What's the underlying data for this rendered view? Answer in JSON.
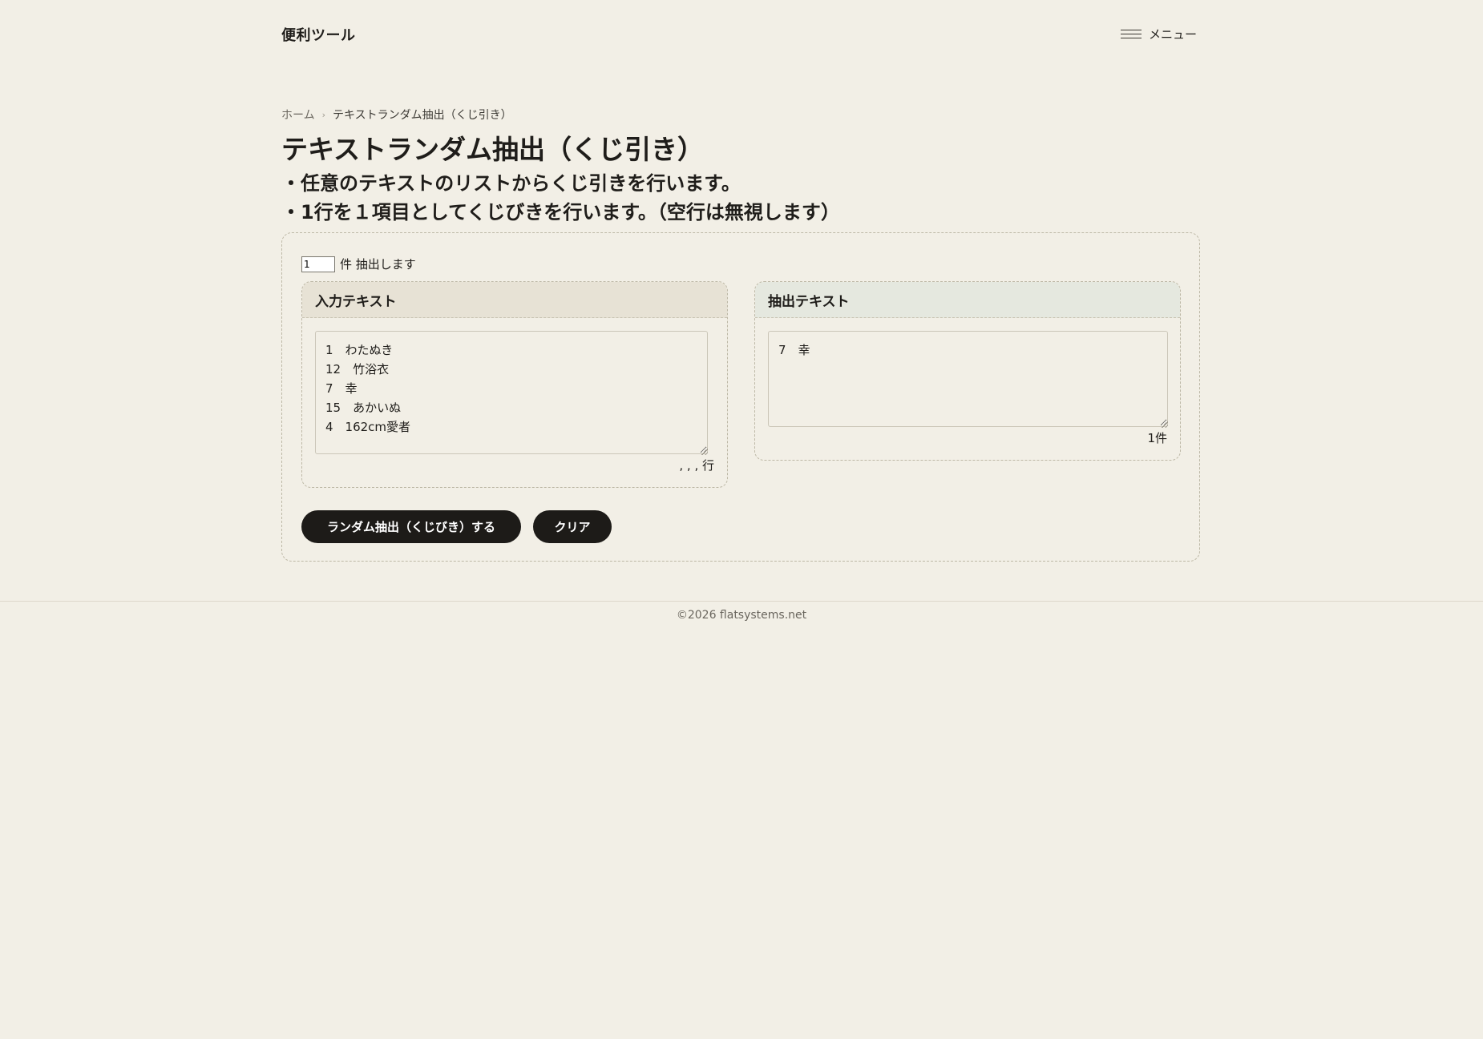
{
  "header": {
    "site_title": "便利ツール",
    "menu_label": "メニュー"
  },
  "breadcrumb": {
    "home": "ホーム",
    "separator": "›",
    "current": "テキストランダム抽出（くじ引き）"
  },
  "page": {
    "title": "テキストランダム抽出（くじ引き）",
    "description_1": "・任意のテキストのリストからくじ引きを行います。",
    "description_2": "・1行を１項目としてくじびきを行います。（空行は無視します）"
  },
  "panel": {
    "count_value": "1",
    "count_suffix": "件 抽出します",
    "input_box": {
      "title": "入力テキスト",
      "text": "1　わたぬき\n12　竹浴衣\n7　幸\n15　あかいぬ\n4　162cm愛者",
      "line_info": ", , , 行"
    },
    "output_box": {
      "title": "抽出テキスト",
      "text": "7　幸",
      "count_info": "1件"
    },
    "buttons": {
      "run": "ランダム抽出（くじびき）する",
      "clear": "クリア"
    }
  },
  "footer": {
    "copyright": "©2026 flatsystems.net"
  }
}
